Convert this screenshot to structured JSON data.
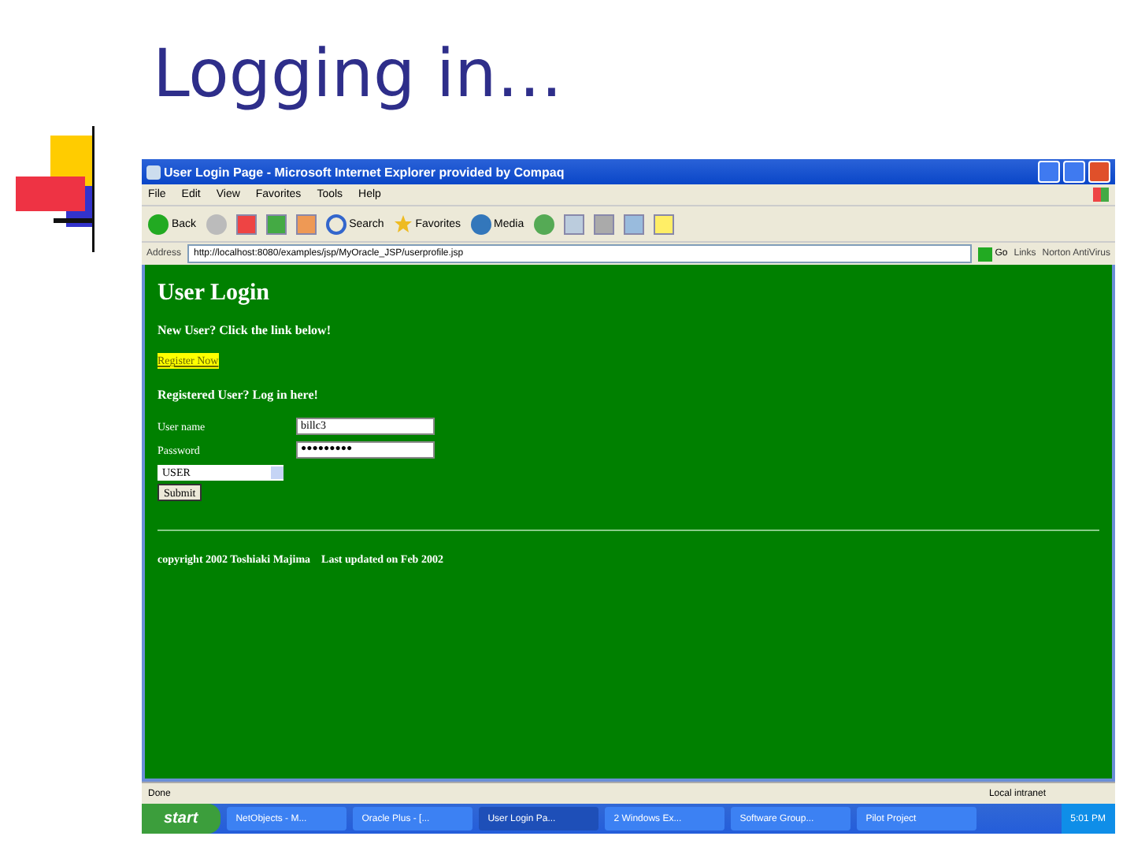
{
  "slide": {
    "title": "Logging in…"
  },
  "window": {
    "title": "User Login Page - Microsoft Internet Explorer provided by Compaq"
  },
  "menu": [
    "File",
    "Edit",
    "View",
    "Favorites",
    "Tools",
    "Help"
  ],
  "toolbar": {
    "back": "Back",
    "search": "Search",
    "favorites": "Favorites",
    "media": "Media"
  },
  "address_bar": {
    "label": "Address",
    "value": "http://localhost:8080/examples/jsp/MyOracle_JSP/userprofile.jsp",
    "go": "Go",
    "links": "Links",
    "extra": "Norton AntiVirus"
  },
  "page": {
    "heading": "User Login",
    "new_user": "New User? Click the link below!",
    "register_link": "Register Now",
    "registered": "Registered User? Log in here!",
    "fields": [
      {
        "label": "User name",
        "value": "billc3",
        "kind": "text"
      },
      {
        "label": "Password",
        "value": "●●●●●●●●●",
        "kind": "password"
      }
    ],
    "role_select": "USER",
    "submit": "Submit",
    "footer": "copyright 2002 Toshiaki Majima    Last updated on Feb 2002"
  },
  "status_bar": {
    "text": "Done",
    "zone": "Local intranet"
  },
  "taskbar": {
    "start": "start",
    "items": [
      {
        "label": "NetObjects - M...",
        "selected": false
      },
      {
        "label": "Oracle Plus - [...",
        "selected": false
      },
      {
        "label": "User Login Pa...",
        "selected": true
      },
      {
        "label": "2 Windows Ex...",
        "selected": false
      },
      {
        "label": "Software Group...",
        "selected": false
      },
      {
        "label": "Pilot Project",
        "selected": false
      }
    ],
    "clock": "5:01 PM"
  }
}
